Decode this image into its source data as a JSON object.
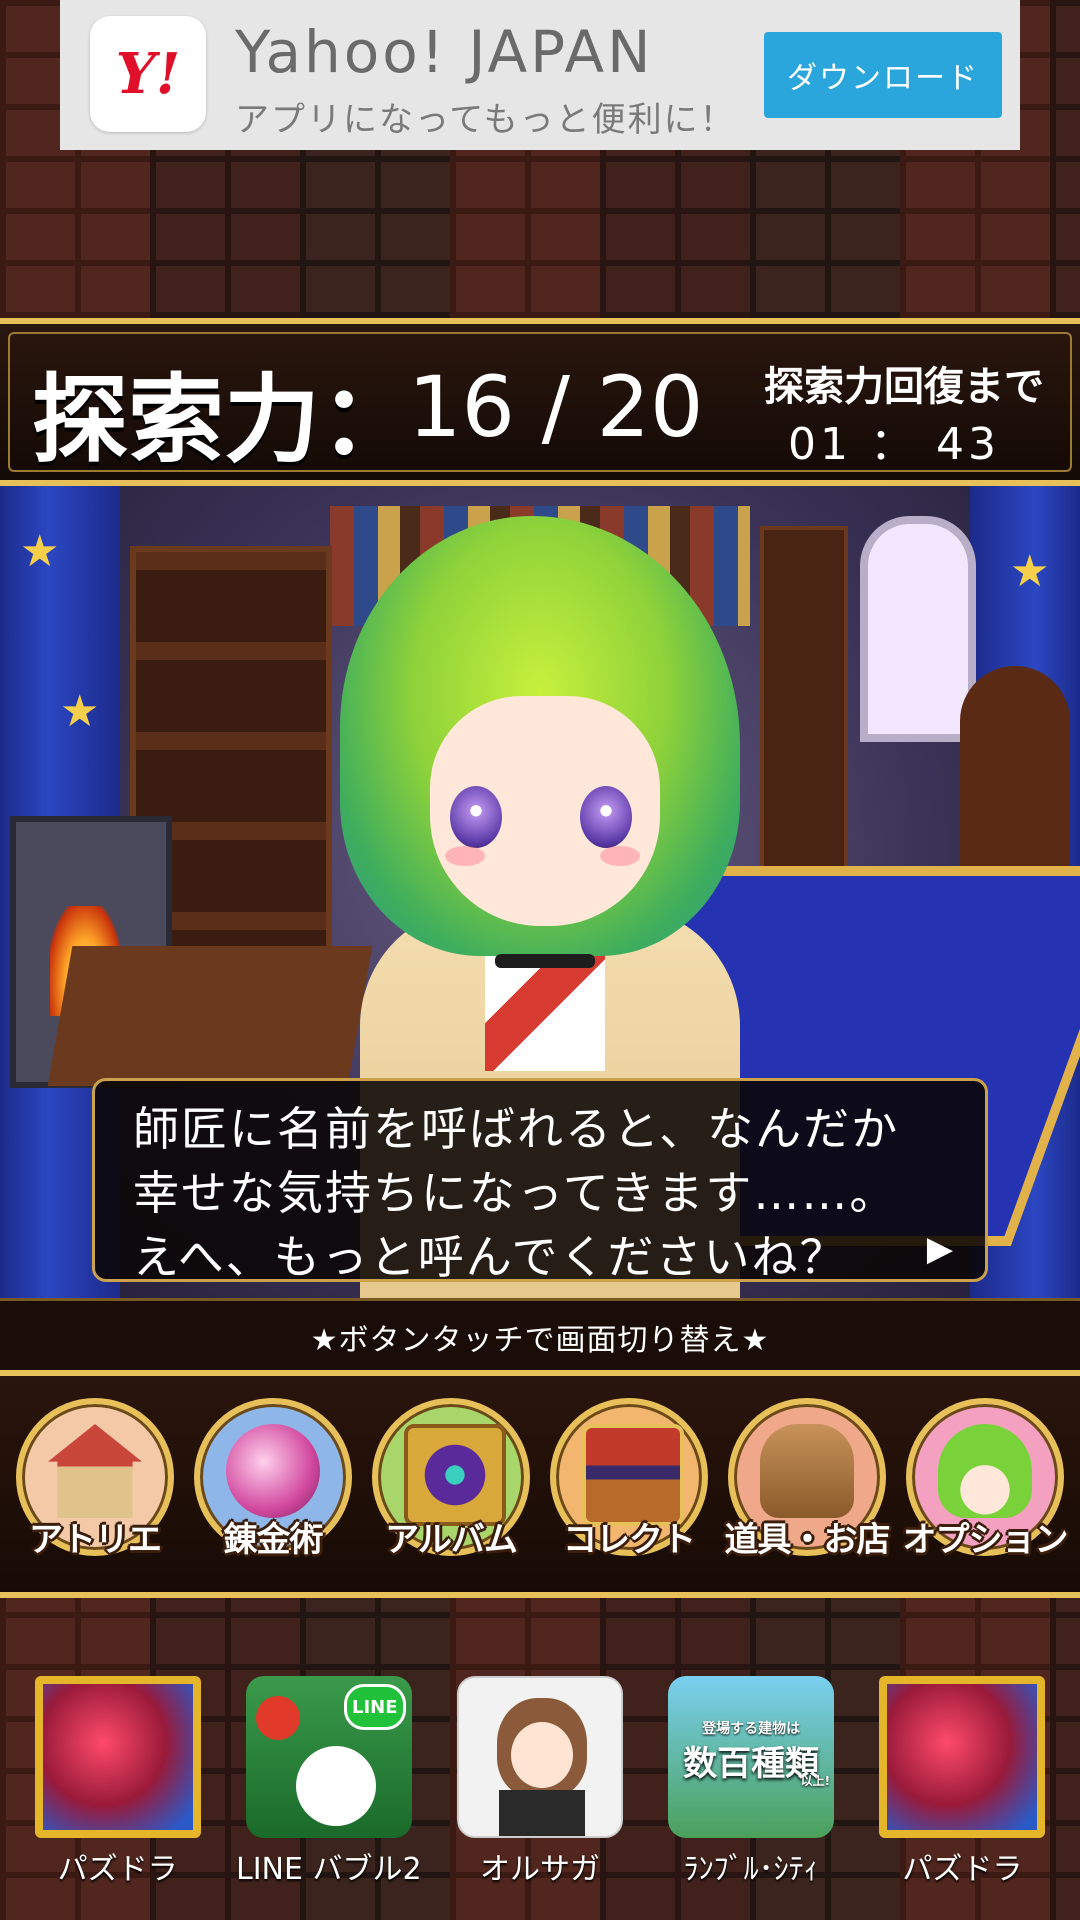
{
  "ad": {
    "logo": "Y!",
    "title": "Yahoo! JAPAN",
    "subtitle": "アプリになってもっと便利に！",
    "button": "ダウンロード"
  },
  "stamina": {
    "label": "探索力：",
    "value": "16 / 20",
    "current": 16,
    "max": 20,
    "recover_label": "探索力回復まで",
    "recover_time": "01 ： 43"
  },
  "dialog": {
    "lines": [
      "師匠に名前を呼ばれると、なんだか",
      "幸せな気持ちになってきます……。",
      "えへ、もっと呼んでくださいね？"
    ],
    "next_glyph": "▶"
  },
  "hint": "★ボタンタッチで画面切り替え★",
  "menu": {
    "items": [
      {
        "label": "アトリエ",
        "icon": "house-icon",
        "bg": "#f3c9a8"
      },
      {
        "label": "錬金術",
        "icon": "potion-icon",
        "bg": "#8fb6e8"
      },
      {
        "label": "アルバム",
        "icon": "book-icon",
        "bg": "#a8d66a"
      },
      {
        "label": "コレクト",
        "icon": "treasure-chest-icon",
        "bg": "#f2b66e"
      },
      {
        "label": "道具・お店",
        "icon": "bag-icon",
        "bg": "#f0a88a"
      },
      {
        "label": "オプション",
        "icon": "character-icon",
        "bg": "#f4a0c0"
      }
    ]
  },
  "apps": [
    {
      "label": "パズドラ",
      "icon": "dragon-icon"
    },
    {
      "label": "LINE バブル2",
      "icon": "line-bubble-icon",
      "badge": "LINE"
    },
    {
      "label": "オルサガ",
      "icon": "maid-icon"
    },
    {
      "label": "ﾗﾝﾌﾞﾙ･ｼﾃｨ",
      "icon": "city-icon",
      "overlay": "数百種類",
      "overlay_small": "登場する建物は",
      "overlay_tiny": "以上!"
    },
    {
      "label": "パズドラ",
      "icon": "dragon-icon"
    }
  ],
  "colors": {
    "gold": "#e7c05a",
    "ad_button": "#2aa6dd",
    "yahoo_red": "#e0102a"
  }
}
